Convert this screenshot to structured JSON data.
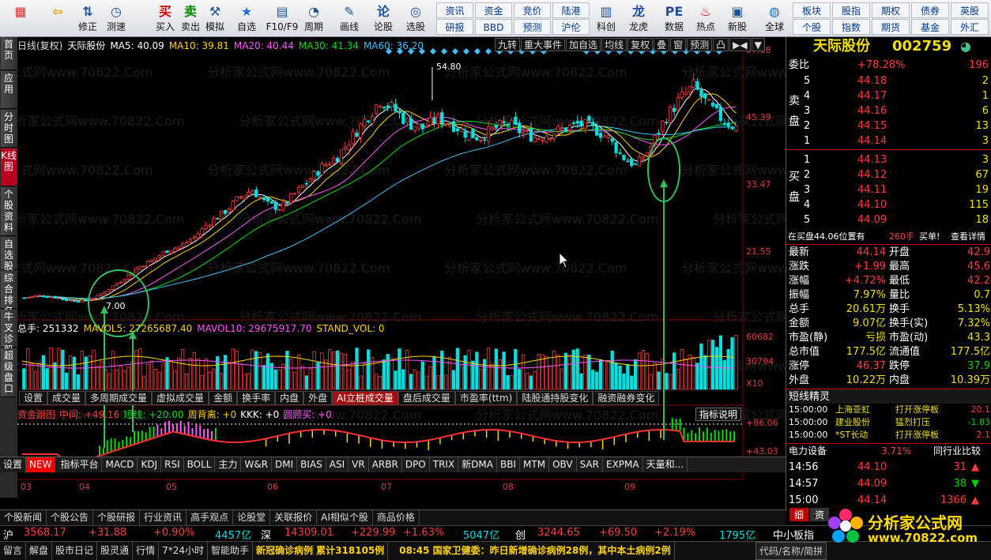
{
  "toolbar": {
    "items": [
      {
        "label": "",
        "icon": "grid-logo-icon"
      },
      {
        "label": "",
        "icon": "back-arrow-icon"
      },
      {
        "label": "修正",
        "icon": "up-down-arrow-icon"
      },
      {
        "label": "测速",
        "icon": "speed-icon"
      },
      {
        "label": "买入",
        "icon": "buy-icon"
      },
      {
        "label": "卖出",
        "icon": "sell-icon"
      },
      {
        "label": "模拟",
        "icon": "hammer-icon"
      },
      {
        "label": "自选",
        "icon": "star-icon"
      },
      {
        "label": "F10/F9",
        "icon": "f10-icon"
      },
      {
        "label": "周期",
        "icon": "clock-icon"
      },
      {
        "label": "画线",
        "icon": "pencil-icon"
      },
      {
        "label": "论股",
        "icon": "discuss-icon"
      },
      {
        "label": "选股",
        "icon": "select-stock-icon"
      },
      {
        "label": "科创",
        "icon": "chart-icon"
      },
      {
        "label": "龙虎",
        "icon": "dragon-icon"
      },
      {
        "label": "数据",
        "icon": "pe-icon"
      },
      {
        "label": "热点",
        "icon": "hot-icon"
      },
      {
        "label": "新股",
        "icon": "ipo-icon"
      },
      {
        "label": "全球",
        "icon": "globe-icon"
      }
    ],
    "small": [
      [
        "资讯",
        "资金",
        "竞价",
        "陆港"
      ],
      [
        "研报",
        "BBD",
        "预测",
        "沪伦"
      ]
    ],
    "small2": [
      [
        "板块",
        "股指",
        "期权",
        "债券",
        "英股"
      ],
      [
        "个股",
        "指数",
        "期货",
        "基金",
        "外汇"
      ]
    ]
  },
  "tabs_left": [
    "首页",
    "应用",
    "分时图",
    "K线图",
    "个股资料",
    "自选股",
    "综合排名",
    "牛叉诊股",
    "超级盘口"
  ],
  "chart": {
    "header": [
      "日线(复权)",
      "天际股份",
      "MA5: 40.09",
      "MA10: 39.81",
      "MA20: 40.44",
      "MA30: 41.34",
      "MA60: 36.20"
    ],
    "header_colors": [
      "#ddd",
      "#fff",
      "#fff",
      "#ffd400",
      "#ff55ff",
      "#00e000",
      "#40c0ff"
    ],
    "tools": [
      "九转",
      "重大事件",
      "加自选",
      "均线",
      "复权",
      "叠",
      "窗",
      "预测",
      "凸",
      "▶◀",
      "▼"
    ],
    "price_axis": [
      "57.18",
      "45.39",
      "33.47",
      "21.55"
    ],
    "peak_label": "54.80",
    "low_label": "7.00",
    "vol_header": [
      "总手: 251332",
      "MAVOL5: 27265687.40",
      "MAVOL10: 29675917.70",
      "STAND_VOL: 0"
    ],
    "vol_header_colors": [
      "#fff",
      "#ffd400",
      "#ff55ff",
      "#ffd400"
    ],
    "vol_axis": [
      "60682",
      "30794",
      "X10"
    ],
    "vol_tabs": [
      "设置",
      "成交量",
      "多周期成交量",
      "虚拟成交量",
      "金额",
      "换手率",
      "内盘",
      "外盘",
      "AI立桩成交量",
      "盘后成交量",
      "市盈率(ttm)",
      "陆股通持股变化",
      "融资融券变化"
    ],
    "ind_header": [
      "资金副图",
      "中间: +49.16",
      "短线: +20.00",
      "周背离: +0",
      "KKK: +0",
      "圆顾买: +0"
    ],
    "ind_header_colors": [
      "#ff3b3b",
      "#ff3b3b",
      "#00e000",
      "#ffd400",
      "#fff",
      "#ff55ff"
    ],
    "ind_explain": "指标说明",
    "ind_axis": [
      "+86.06",
      "+43.03"
    ],
    "months": [
      "03",
      "04",
      "05",
      "06",
      "07",
      "08",
      "09"
    ],
    "watermark": "分析家公式网www.70822.Com"
  },
  "chart_data": {
    "type": "candlestick",
    "title": "天际股份 日线(复权)",
    "ylim": [
      7,
      57.18
    ],
    "peak": 54.8,
    "low": 7.0,
    "ma": {
      "MA5": 40.09,
      "MA10": 39.81,
      "MA20": 40.44,
      "MA30": 41.34,
      "MA60": 36.2
    },
    "close_path": [
      8,
      8.5,
      8.2,
      7.5,
      7.3,
      8,
      10,
      12,
      14.5,
      16,
      18,
      19,
      21,
      24,
      26,
      29,
      31,
      28,
      27,
      30,
      33,
      36,
      38,
      42,
      46,
      50,
      48,
      45,
      44,
      46,
      45,
      43,
      42,
      44,
      45,
      43,
      42,
      43,
      44,
      45,
      44,
      42,
      38,
      36,
      40,
      46,
      50,
      53,
      49,
      46,
      44.1
    ],
    "volume_peak": 60682
  },
  "quote": {
    "name": "天际股份",
    "code": "002759",
    "weibi": "委比",
    "weibi_val": "+78.28%",
    "weibi_count": "196",
    "asks": [
      [
        "5",
        "44.18",
        "2"
      ],
      [
        "4",
        "44.17",
        "1"
      ],
      [
        "3",
        "44.16",
        "6"
      ],
      [
        "2",
        "44.15",
        "13"
      ],
      [
        "1",
        "44.14",
        "3"
      ]
    ],
    "ask_label": "卖盘",
    "bid_label": "买盘",
    "bids": [
      [
        "1",
        "44.13",
        "3"
      ],
      [
        "2",
        "44.12",
        "67"
      ],
      [
        "3",
        "44.11",
        "19"
      ],
      [
        "4",
        "44.10",
        "115"
      ],
      [
        "5",
        "44.09",
        "18"
      ]
    ],
    "note1": "在买盘44.06位置有",
    "note2": "260手",
    "note3": "买单!",
    "note4": "查看详情",
    "stats": [
      [
        "最新",
        "44.14",
        "开盘",
        "42.9"
      ],
      [
        "涨跌",
        "+1.99",
        "最高",
        "45.6"
      ],
      [
        "涨幅",
        "+4.72%",
        "最低",
        "42.2"
      ],
      [
        "振幅",
        "7.97%",
        "量比",
        "0.7"
      ],
      [
        "总手",
        "20.61万",
        "换手",
        "5.13%"
      ],
      [
        "金额",
        "9.07亿",
        "换手(实)",
        "7.32%"
      ],
      [
        "市盈(静)",
        "亏损",
        "市盈(动)",
        "43.3"
      ],
      [
        "总市值",
        "177.5亿",
        "流通值",
        "177.5亿"
      ],
      [
        "涨停",
        "46.37",
        "跌停",
        "37.9"
      ],
      [
        "外盘",
        "10.22万",
        "内盘",
        "10.39万"
      ]
    ],
    "elves_title": "短线精灵",
    "elves": [
      [
        "15:00:00",
        "上海亚虹",
        "打开涨停板",
        "20.1"
      ],
      [
        "15:00:00",
        "建业股份",
        "猛烈打压",
        "-1.83"
      ],
      [
        "15:00:00",
        "*ST长动",
        "打开涨停板",
        "2.1"
      ]
    ],
    "sector": "电力设备",
    "sector_pct": "3.71%",
    "sector_btn": "同行业比较",
    "ticks": [
      [
        "14:56",
        "44.10",
        "31",
        "▲"
      ],
      [
        "14:57",
        "44.09",
        "38",
        "▼"
      ],
      [
        "15:00",
        "44.14",
        "1366",
        "▲"
      ]
    ],
    "tabs": [
      "细",
      "资"
    ]
  },
  "ind_tabs": [
    "设置",
    "NEW",
    "指标平台",
    "MACD",
    "KDJ",
    "RSI",
    "BOLL",
    "主力",
    "W&R",
    "DMI",
    "BIAS",
    "ASI",
    "VR",
    "ARBR",
    "DPO",
    "TRIX",
    "新DMA",
    "BBI",
    "MTM",
    "OBV",
    "SAR",
    "EXPMA",
    "天量和..."
  ],
  "bottom_tabs": [
    "个股新闻",
    "个股公告",
    "个股研报",
    "行业资讯",
    "高手观点",
    "论股堂",
    "关联报价",
    "AI相似个股",
    "商品价格"
  ],
  "ticker": [
    [
      "沪",
      "3568.17",
      "+31.88",
      "+0.90%",
      "4457亿"
    ],
    [
      "深",
      "14309.01",
      "+229.99",
      "+1.63%",
      "5047亿"
    ],
    [
      "创",
      "3244.65",
      "+69.50",
      "+2.19%",
      "1795亿"
    ]
  ],
  "ticker_extra": "中小板指",
  "status": [
    "留言",
    "解盘",
    "股市日记",
    "股灵通",
    "行情",
    "7*24小时",
    "智能助手"
  ],
  "news1": "新冠确诊病例 累计318105例",
  "news2": "08:45 国家卫健委：昨日新增确诊病例28例，其中本土病例2例",
  "search_hint": "代码/名称/简拼",
  "logo": {
    "title": "分析家公式网",
    "url": "www.70822.com"
  }
}
